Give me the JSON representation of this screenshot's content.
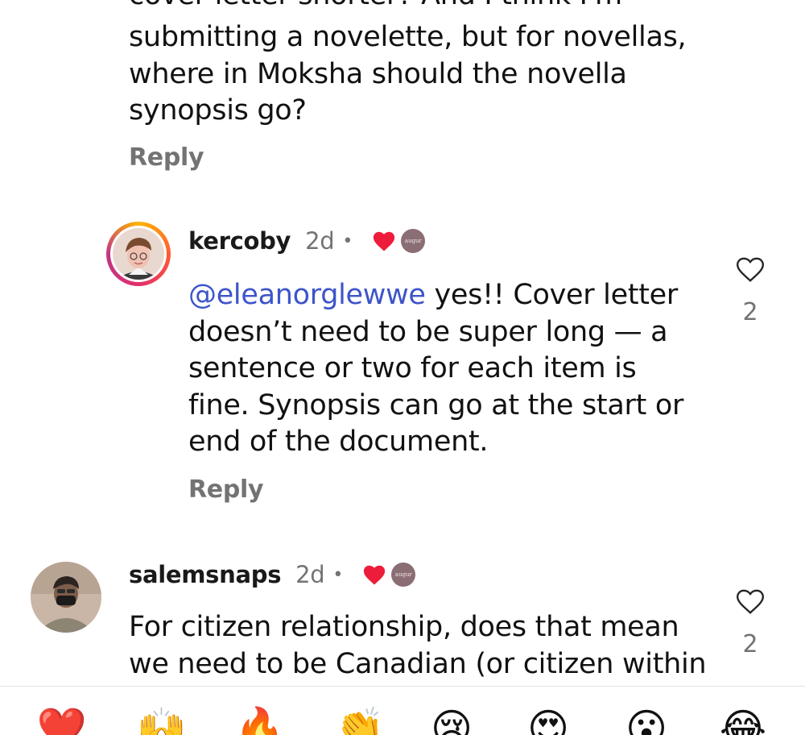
{
  "top_comment": {
    "partial_first_line": "cover letter shorter? And I think I'm",
    "text": "submitting a novelette, but for novellas,\nwhere in Moksha should the novella\nsynopsis go?",
    "reply_label": "Reply"
  },
  "reply_comment": {
    "username": "kercoby",
    "time": "2d",
    "dot": "•",
    "mention": "@eleanorglewwe",
    "text_line1": " yes!! Cover letter",
    "text_rest": "doesn’t need to be super long — a\nsentence or two for each item is\nfine. Synopsis can go at the start or\nend of the document.",
    "reply_label": "Reply",
    "like_count": "2",
    "author_liked_icon": "heart-filled-icon",
    "author_badge_text": "augur",
    "like_icon": "heart-outline-icon"
  },
  "second_comment": {
    "username": "salemsnaps",
    "time": "2d",
    "dot": "•",
    "text": "For citizen relationship, does that mean\nwe need to be Canadian (or citizen within",
    "like_count": "2",
    "author_liked_icon": "heart-filled-icon",
    "author_badge_text": "augur",
    "like_icon": "heart-outline-icon"
  },
  "reactions": [
    {
      "emoji": "❤️",
      "name": "red-heart"
    },
    {
      "emoji": "🙌",
      "name": "raising-hands"
    },
    {
      "emoji": "🔥",
      "name": "fire"
    },
    {
      "emoji": "👏",
      "name": "clapping-hands"
    },
    {
      "emoji": "😢",
      "name": "crying-face"
    },
    {
      "emoji": "😍",
      "name": "heart-eyes"
    },
    {
      "emoji": "😮",
      "name": "surprised-face"
    },
    {
      "emoji": "😂",
      "name": "tears-of-joy"
    }
  ],
  "colors": {
    "mention": "#3d55c9",
    "heart": "#ed1c3a",
    "muted": "#737373",
    "badge": "#8a6e74"
  }
}
